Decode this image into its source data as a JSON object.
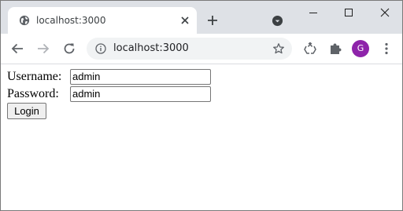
{
  "tab": {
    "title": "localhost:3000",
    "favicon": "globe-icon"
  },
  "omnibox": {
    "url": "localhost:3000",
    "info_icon": "info-icon",
    "bookmark_icon": "star-icon"
  },
  "toolbar": {
    "profile_initial": "G",
    "profile_color": "#8e24aa"
  },
  "form": {
    "username_label": "Username:",
    "username_value": "admin",
    "password_label": "Password:",
    "password_value": "admin",
    "login_label": "Login"
  },
  "colors": {
    "tabstrip_bg": "#dee1e6",
    "omnibox_bg": "#f1f3f4"
  }
}
